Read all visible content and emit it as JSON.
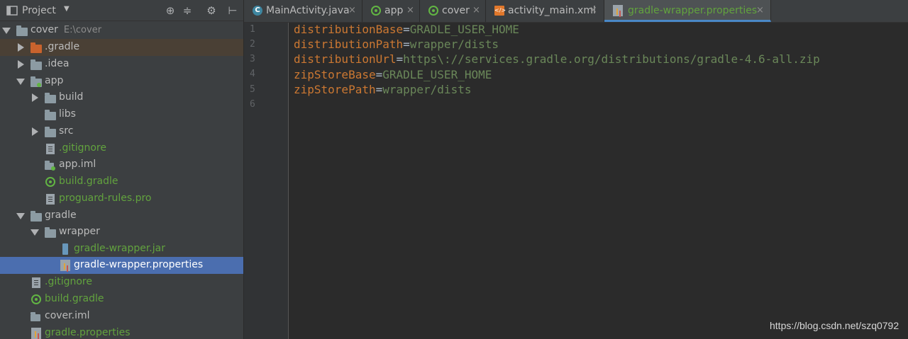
{
  "project_panel": {
    "title": "Project",
    "dropdown_icon": "chevron-down-icon",
    "toolbar_icons": [
      "target-icon",
      "collapse-icon",
      "gear-icon",
      "hide-icon"
    ],
    "tree": [
      {
        "label": "cover",
        "hint": "E:\\cover"
      },
      {
        "label": ".gradle"
      },
      {
        "label": ".idea"
      },
      {
        "label": "app"
      },
      {
        "label": "build"
      },
      {
        "label": "libs"
      },
      {
        "label": "src"
      },
      {
        "label": ".gitignore"
      },
      {
        "label": "app.iml"
      },
      {
        "label": "build.gradle"
      },
      {
        "label": "proguard-rules.pro"
      },
      {
        "label": "gradle"
      },
      {
        "label": "wrapper"
      },
      {
        "label": "gradle-wrapper.jar"
      },
      {
        "label": "gradle-wrapper.properties"
      },
      {
        "label": ".gitignore"
      },
      {
        "label": "build.gradle"
      },
      {
        "label": "cover.iml"
      },
      {
        "label": "gradle.properties"
      }
    ]
  },
  "tabs": [
    {
      "label": "MainActivity.java",
      "icon": "class-icon"
    },
    {
      "label": "app",
      "icon": "gradle-icon"
    },
    {
      "label": "cover",
      "icon": "gradle-icon"
    },
    {
      "label": "activity_main.xml",
      "icon": "xml-icon"
    },
    {
      "label": "gradle-wrapper.properties",
      "icon": "properties-icon",
      "active": true
    }
  ],
  "close_glyph": "×",
  "editor": {
    "line_numbers": [
      "1",
      "2",
      "3",
      "4",
      "5",
      "6"
    ],
    "lines": [
      {
        "key": "distributionBase",
        "eq": "=",
        "value": "GRADLE_USER_HOME"
      },
      {
        "key": "distributionPath",
        "eq": "=",
        "value": "wrapper/dists"
      },
      {
        "key": "distributionUrl",
        "eq": "=",
        "value": "https\\://services.gradle.org/distributions/gradle-4.6-all.zip"
      },
      {
        "key": "zipStoreBase",
        "eq": "=",
        "value": "GRADLE_USER_HOME"
      },
      {
        "key": "zipStorePath",
        "eq": "=",
        "value": "wrapper/dists"
      }
    ]
  },
  "watermark": "https://blog.csdn.net/szq0792"
}
